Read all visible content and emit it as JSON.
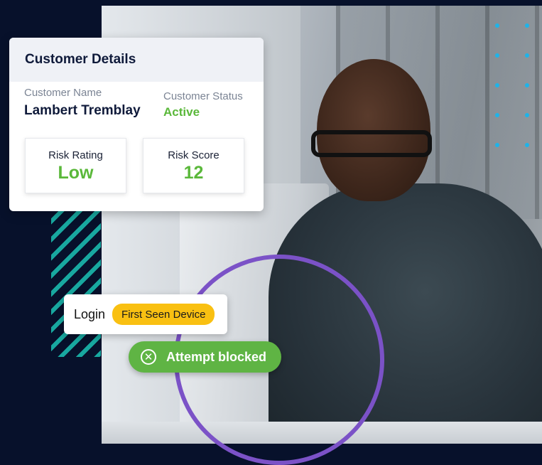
{
  "customer_card": {
    "title": "Customer Details",
    "name_label": "Customer Name",
    "name_value": "Lambert Tremblay",
    "status_label": "Customer Status",
    "status_value": "Active",
    "risk_rating_label": "Risk Rating",
    "risk_rating_value": "Low",
    "risk_score_label": "Risk Score",
    "risk_score_value": "12"
  },
  "login_event": {
    "label": "Login",
    "badge": "First Seen Device"
  },
  "alert": {
    "icon": "close-circle-icon",
    "text": "Attempt blocked"
  },
  "colors": {
    "background": "#07112b",
    "success": "#5ab83a",
    "badge": "#f9c012",
    "ring": "#7b52c7",
    "stripes": "#18a8a0",
    "dots": "#1fb3e8"
  }
}
